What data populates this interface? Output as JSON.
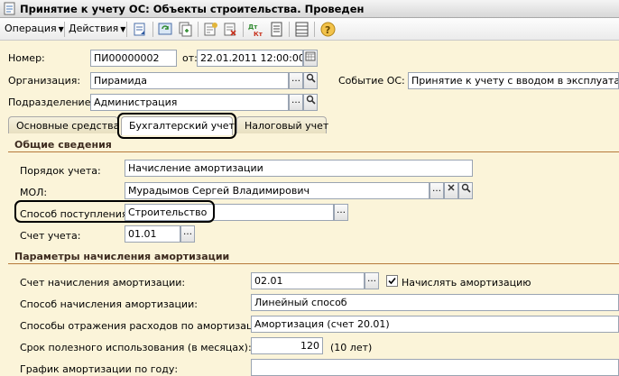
{
  "window": {
    "title": "Принятие к учету ОС: Объекты строительства. Проведен"
  },
  "toolbar": {
    "operation_label": "Операция",
    "actions_label": "Действия"
  },
  "header": {
    "number_label": "Номер:",
    "number_value": "ПИ00000002",
    "from_label": "от:",
    "date_value": "22.01.2011 12:00:00",
    "org_label": "Организация:",
    "org_value": "Пирамида",
    "event_label": "Событие ОС:",
    "event_value": "Принятие к учету с вводом в эксплуатацию",
    "dept_label": "Подразделение:",
    "dept_value": "Администрация"
  },
  "tabs": [
    {
      "label": "Основные средства"
    },
    {
      "label": "Бухгалтерский учет"
    },
    {
      "label": "Налоговый учет"
    }
  ],
  "general": {
    "title": "Общие сведения",
    "order_label": "Порядок учета:",
    "order_value": "Начисление амортизации",
    "mol_label": "МОЛ:",
    "mol_value": "Мурадымов Сергей Владимирович",
    "receipt_label": "Способ поступления:",
    "receipt_value": "Строительство",
    "account_label": "Счет учета:",
    "account_value": "01.01"
  },
  "amort": {
    "title": "Параметры начисления амортизации",
    "account_label": "Счет начисления амортизации:",
    "account_value": "02.01",
    "charge_label": "Начислять амортизацию",
    "charge_checked": true,
    "method_label": "Способ начисления амортизации:",
    "method_value": "Линейный способ",
    "expense_label": "Способы отражения расходов по амортизации:",
    "expense_value": "Амортизация (счет 20.01)",
    "life_label": "Срок полезного использования (в месяцах):",
    "life_value": "120",
    "life_years": "(10 лет)",
    "schedule_label": "График амортизации по году:"
  }
}
